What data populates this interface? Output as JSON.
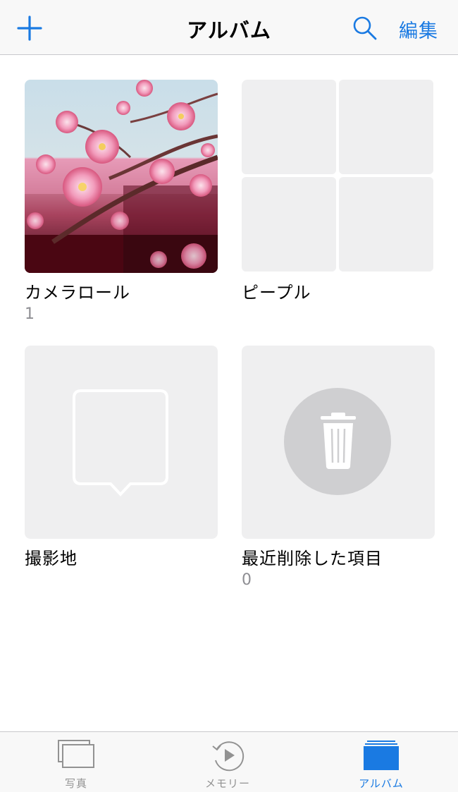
{
  "navbar": {
    "title": "アルバム",
    "edit_label": "編集"
  },
  "albums": [
    {
      "title": "カメラロール",
      "count": "1"
    },
    {
      "title": "ピープル",
      "count": ""
    },
    {
      "title": "撮影地",
      "count": ""
    },
    {
      "title": "最近削除した項目",
      "count": "0"
    }
  ],
  "tabbar": {
    "tabs": [
      {
        "label": "写真",
        "icon": "photos-icon",
        "active": false
      },
      {
        "label": "メモリー",
        "icon": "memories-icon",
        "active": false
      },
      {
        "label": "アルバム",
        "icon": "albums-icon",
        "active": true
      }
    ]
  },
  "colors": {
    "accent": "#1a7ae2",
    "inactive": "#929292",
    "placeholder": "#efeff0"
  }
}
